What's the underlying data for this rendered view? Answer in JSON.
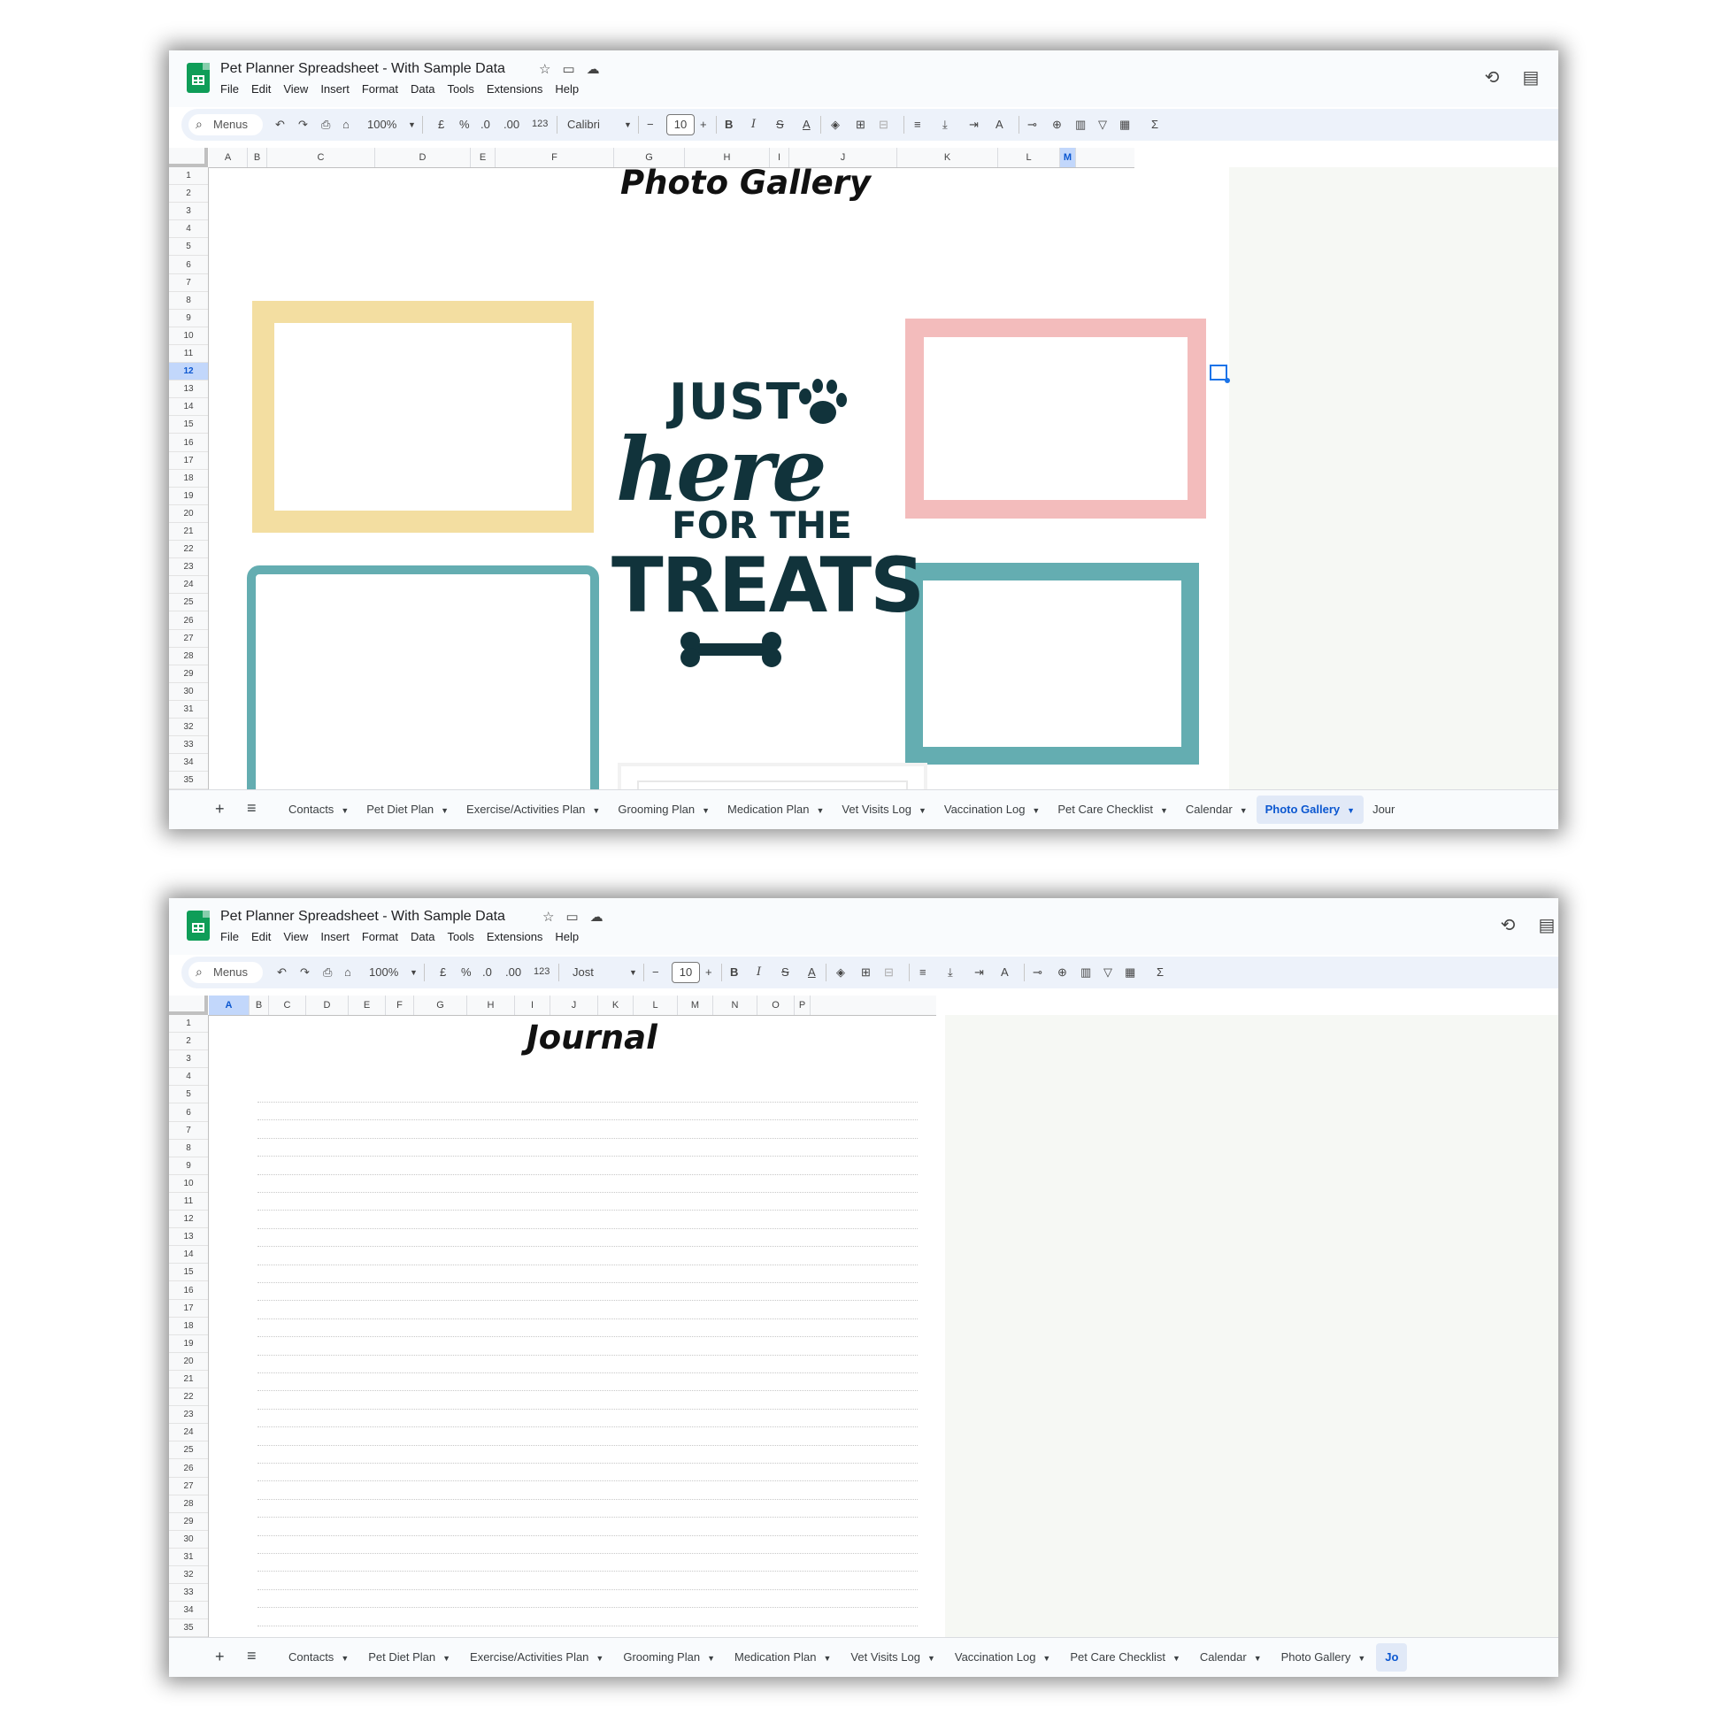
{
  "windows": [
    {
      "title": "Pet Planner Spreadsheet - With Sample Data",
      "title_icons": [
        "star-icon",
        "folder-move-icon",
        "cloud-saved-icon"
      ],
      "menu": [
        "File",
        "Edit",
        "View",
        "Insert",
        "Format",
        "Data",
        "Tools",
        "Extensions",
        "Help"
      ],
      "toolbar": {
        "search_label": "Menus",
        "zoom": "100%",
        "currency": "£",
        "percent": "%",
        "dec_decrease": ".0",
        "dec_increase": ".00",
        "number_format": "123",
        "font": "Calibri",
        "font_size": "10"
      },
      "columns": [
        "A",
        "B",
        "C",
        "D",
        "E",
        "F",
        "G",
        "H",
        "I",
        "J",
        "K",
        "L",
        "M"
      ],
      "selected_column": "M",
      "rows": [
        "1",
        "2",
        "3",
        "4",
        "5",
        "6",
        "7",
        "8",
        "9",
        "10",
        "11",
        "12",
        "13",
        "14",
        "15",
        "16",
        "17",
        "18",
        "19",
        "20",
        "21",
        "22",
        "23",
        "24",
        "25",
        "26",
        "27",
        "28",
        "29",
        "30",
        "31",
        "32",
        "33",
        "34",
        "35"
      ],
      "selected_row": "12",
      "sheet_title": "Photo Gallery",
      "graphic_text": {
        "line1": "JUST",
        "line2": "here",
        "line3": "FOR THE",
        "line4": "TREATS"
      },
      "frame_colors": {
        "yellow": "#f3dea1",
        "pink": "#f3bcbc",
        "teal": "#64adb1",
        "white": "#f2f2f2"
      },
      "tabs": [
        "Contacts",
        "Pet Diet Plan",
        "Exercise/Activities Plan",
        "Grooming Plan",
        "Medication Plan",
        "Vet Visits Log",
        "Vaccination Log",
        "Pet Care Checklist",
        "Calendar",
        "Photo Gallery",
        "Jour"
      ],
      "active_tab": "Photo Gallery"
    },
    {
      "title": "Pet Planner Spreadsheet - With Sample Data",
      "title_icons": [
        "star-icon",
        "folder-move-icon",
        "cloud-saved-icon"
      ],
      "menu": [
        "File",
        "Edit",
        "View",
        "Insert",
        "Format",
        "Data",
        "Tools",
        "Extensions",
        "Help"
      ],
      "toolbar": {
        "search_label": "Menus",
        "zoom": "100%",
        "currency": "£",
        "percent": "%",
        "dec_decrease": ".0",
        "dec_increase": ".00",
        "number_format": "123",
        "font": "Jost",
        "font_size": "10"
      },
      "columns": [
        "A",
        "B",
        "C",
        "D",
        "E",
        "F",
        "G",
        "H",
        "I",
        "J",
        "K",
        "L",
        "M",
        "N",
        "O",
        "P"
      ],
      "selected_column": "A",
      "rows": [
        "1",
        "2",
        "3",
        "4",
        "5",
        "6",
        "7",
        "8",
        "9",
        "10",
        "11",
        "12",
        "13",
        "14",
        "15",
        "16",
        "17",
        "18",
        "19",
        "20",
        "21",
        "22",
        "23",
        "24",
        "25",
        "26",
        "27",
        "28",
        "29",
        "30",
        "31",
        "32",
        "33",
        "34",
        "35"
      ],
      "sheet_title": "Journal",
      "tabs": [
        "Contacts",
        "Pet Diet Plan",
        "Exercise/Activities Plan",
        "Grooming Plan",
        "Medication Plan",
        "Vet Visits Log",
        "Vaccination Log",
        "Pet Care Checklist",
        "Calendar",
        "Photo Gallery",
        "Jo"
      ],
      "active_tab": "Jo"
    }
  ]
}
